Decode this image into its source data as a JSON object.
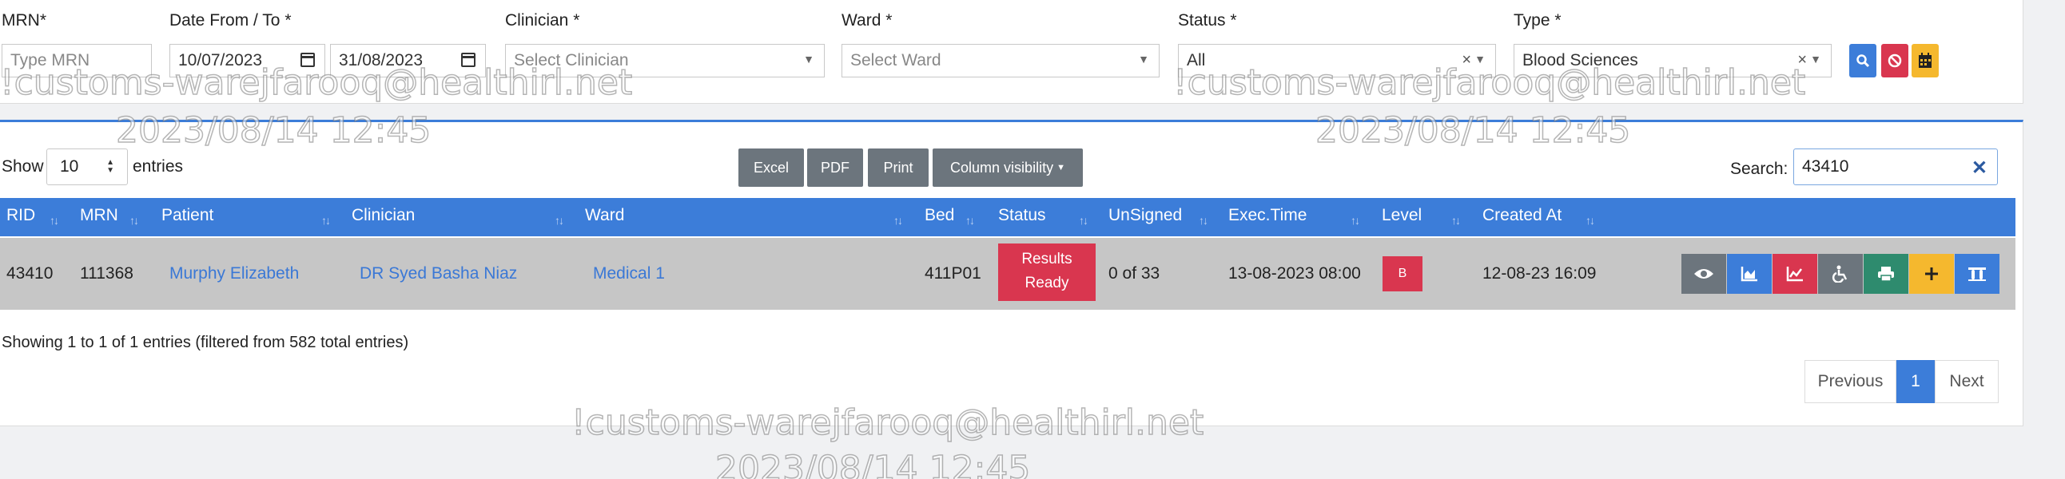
{
  "filters": {
    "mrn": {
      "label": "MRN*",
      "placeholder": "Type MRN"
    },
    "date": {
      "label": "Date From / To *",
      "from": "10/07/2023",
      "to": "31/08/2023"
    },
    "clinician": {
      "label": "Clinician *",
      "placeholder": "Select Clinician"
    },
    "ward": {
      "label": "Ward *",
      "placeholder": "Select Ward"
    },
    "status": {
      "label": "Status *",
      "value": "All"
    },
    "type": {
      "label": "Type *",
      "value": "Blood Sciences"
    },
    "buttons": {
      "search_icon": "search-icon",
      "reset_icon": "ban-icon",
      "calendar_icon": "calendar-icon"
    }
  },
  "table_controls": {
    "show_label": "Show",
    "page_length": "10",
    "entries_label": "entries",
    "export_buttons": [
      "Excel",
      "PDF",
      "Print",
      "Column visibility"
    ],
    "search_label": "Search:",
    "search_value": "43410"
  },
  "table": {
    "columns": [
      "RID",
      "MRN",
      "Patient",
      "Clinician",
      "Ward",
      "Bed",
      "Status",
      "UnSigned",
      "Exec.Time",
      "Level",
      "Created At"
    ],
    "rows": [
      {
        "rid": "43410",
        "mrn": "111368",
        "patient": "Murphy Elizabeth",
        "clinician": "DR Syed Basha Niaz",
        "ward": "Medical 1",
        "bed": "411P01",
        "status_line1": "Results",
        "status_line2": "Ready",
        "unsigned": "0 of 33",
        "exec_time": "13-08-2023 08:00",
        "level": "B",
        "created_at": "12-08-23 16:09"
      }
    ],
    "row_actions": [
      "eye-icon",
      "chart-area-icon",
      "chart-line-icon",
      "wheelchair-icon",
      "print-icon",
      "plus-icon",
      "tube-rack-icon"
    ]
  },
  "footer": {
    "info": "Showing 1 to 1 of 1 entries (filtered from 582 total entries)",
    "pagination": {
      "previous": "Previous",
      "current": "1",
      "next": "Next"
    }
  },
  "watermark": {
    "text": "!customs-warejfarooq@healthirl.net",
    "date": "2023/08/14 12:45"
  },
  "colors": {
    "primary": "#3c7dd9",
    "danger": "#d9364f",
    "secondary": "#6c757d",
    "warning": "#f5b82e",
    "success": "#2e8b6e"
  }
}
